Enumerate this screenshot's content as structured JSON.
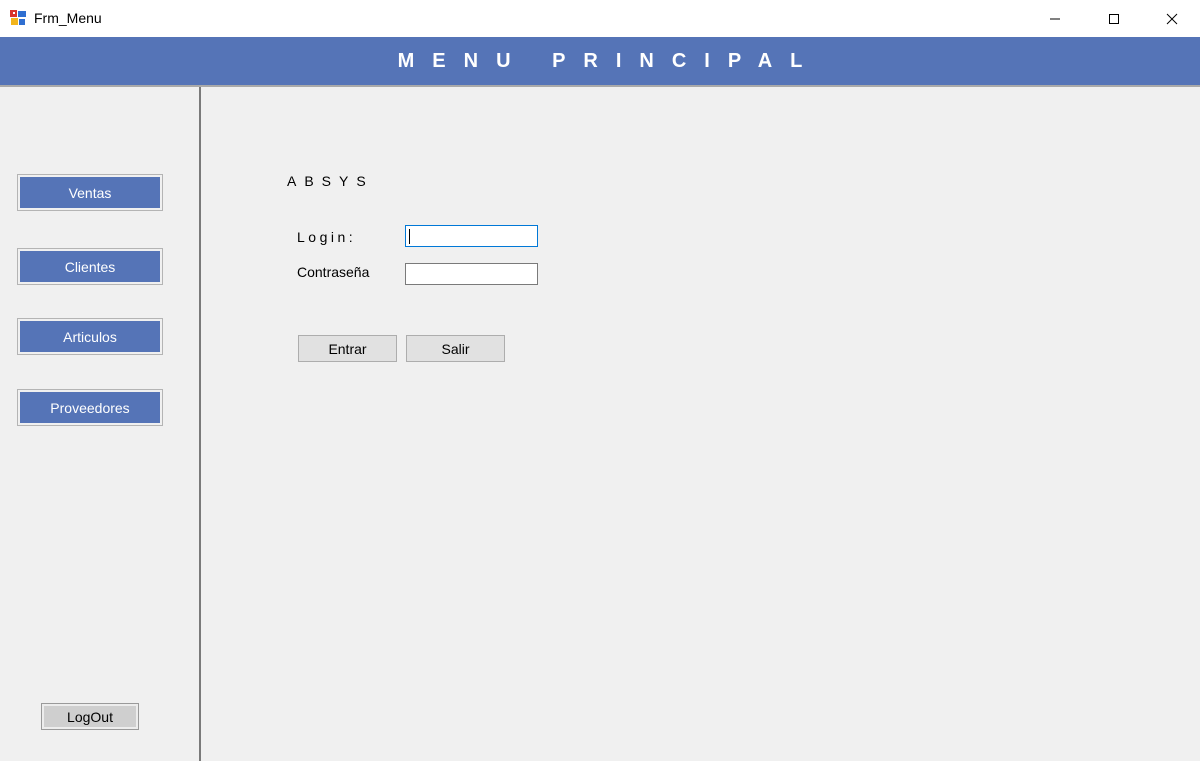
{
  "window": {
    "title": "Frm_Menu",
    "icon": "app-form-icon",
    "controls": {
      "minimize": "minimize-icon",
      "maximize": "maximize-icon",
      "close": "close-icon"
    }
  },
  "header": {
    "title": "MENU PRINCIPAL"
  },
  "sidebar": {
    "items": [
      {
        "label": "Ventas"
      },
      {
        "label": "Clientes"
      },
      {
        "label": "Articulos"
      },
      {
        "label": "Proveedores"
      }
    ],
    "logout_label": "LogOut"
  },
  "login": {
    "brand": "ABSYS",
    "login_label": "Login:",
    "login_value": "",
    "password_label": "Contraseña",
    "password_value": "",
    "enter_label": "Entrar",
    "exit_label": "Salir"
  },
  "colors": {
    "accent": "#5574b7",
    "focus": "#0078d7",
    "button_face": "#e1e1e1"
  }
}
